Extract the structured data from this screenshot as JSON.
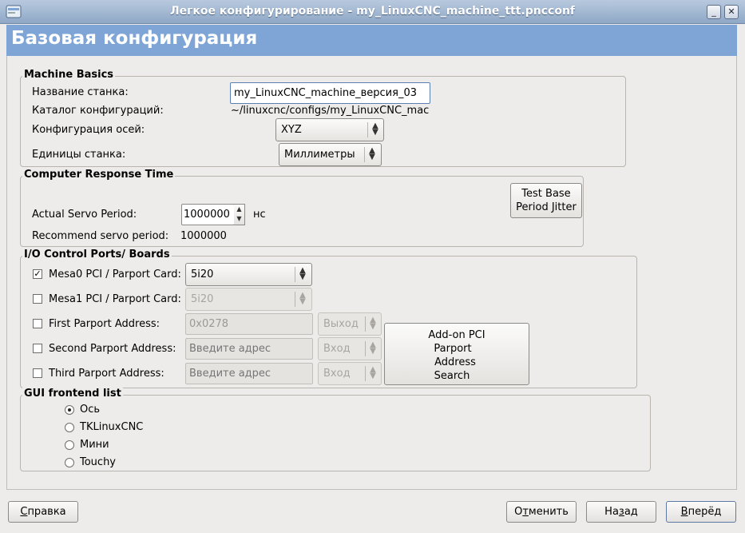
{
  "window": {
    "title": "Легкое конфигурирование - my_LinuxCNC_machine_ttt.pncconf",
    "minimize_glyph": "_",
    "close_glyph": "✕"
  },
  "banner": {
    "title": "Базовая конфигурация"
  },
  "machine_basics": {
    "label": "Machine Basics",
    "name_label": "Название станка:",
    "name_value": "my_LinuxCNC_machine_версия_03",
    "dir_label": "Каталог конфигураций:",
    "dir_value": "~/linuxcnc/configs/my_LinuxCNC_mac",
    "axis_label": "Конфигурация осей:",
    "axis_value": "XYZ",
    "units_label": "Единицы станка:",
    "units_value": "Миллиметры"
  },
  "response": {
    "label": "Computer Response Time",
    "servo_label": "Actual Servo Period:",
    "servo_value": "1000000",
    "servo_unit": "нс",
    "recommend_label": "Recommend servo period:",
    "recommend_value": "1000000",
    "test_button_line1": "Test Base",
    "test_button_line2": "Period Jitter"
  },
  "io": {
    "label": "I/O Control Ports/ Boards",
    "mesa0": {
      "label": "Mesa0 PCI / Parport Card:",
      "checked": true,
      "value": "5i20"
    },
    "mesa1": {
      "label": "Mesa1 PCI / Parport Card:",
      "checked": false,
      "value": "5i20"
    },
    "parport1": {
      "label": "First Parport Address:",
      "value": "0x0278",
      "direction": "Выход"
    },
    "parport2": {
      "label": "Second Parport Address:",
      "placeholder": "Введите адрес",
      "direction": "Вход"
    },
    "parport3": {
      "label": "Third Parport Address:",
      "placeholder": "Введите адрес",
      "direction": "Вход"
    },
    "search_button": {
      "line1": "Add-on PCI",
      "line2": "Parport",
      "line3": "Address",
      "line4": "Search"
    }
  },
  "gui": {
    "label": "GUI frontend list",
    "options": [
      {
        "label": "Ось",
        "selected": true
      },
      {
        "label": "TKLinuxCNC",
        "selected": false
      },
      {
        "label": "Мини",
        "selected": false
      },
      {
        "label": "Touchy",
        "selected": false
      }
    ]
  },
  "footer": {
    "help": {
      "mnemonic": "С",
      "rest": "правка"
    },
    "cancel": {
      "pre": "О",
      "mnemonic": "т",
      "rest": "менить"
    },
    "back": {
      "pre": "На",
      "mnemonic": "з",
      "rest": "ад"
    },
    "forward": {
      "mnemonic": "В",
      "rest": "перёд"
    }
  }
}
